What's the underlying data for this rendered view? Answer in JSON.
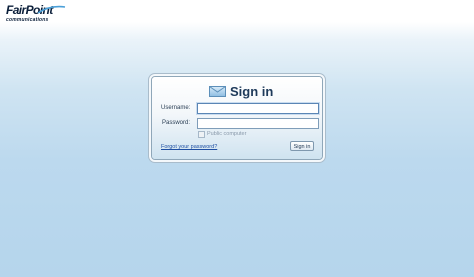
{
  "brand": {
    "name": "FairPoint",
    "tagline": "communications"
  },
  "login": {
    "title": "Sign in",
    "username_label": "Username:",
    "username_value": "",
    "password_label": "Password:",
    "password_value": "",
    "public_computer_label": "Public computer",
    "public_computer_checked": false,
    "forgot_link": "Forgot your password?",
    "submit_label": "Sign in"
  },
  "icons": {
    "title_icon": "envelope-icon",
    "logo_icon": "fairpoint-swoosh-icon"
  },
  "colors": {
    "title_text": "#1e3a5a",
    "link": "#1f4fa3",
    "background_bottom": "#b5d5ec",
    "brand_navy": "#0b1f3a",
    "brand_accent": "#4a9fd8"
  }
}
